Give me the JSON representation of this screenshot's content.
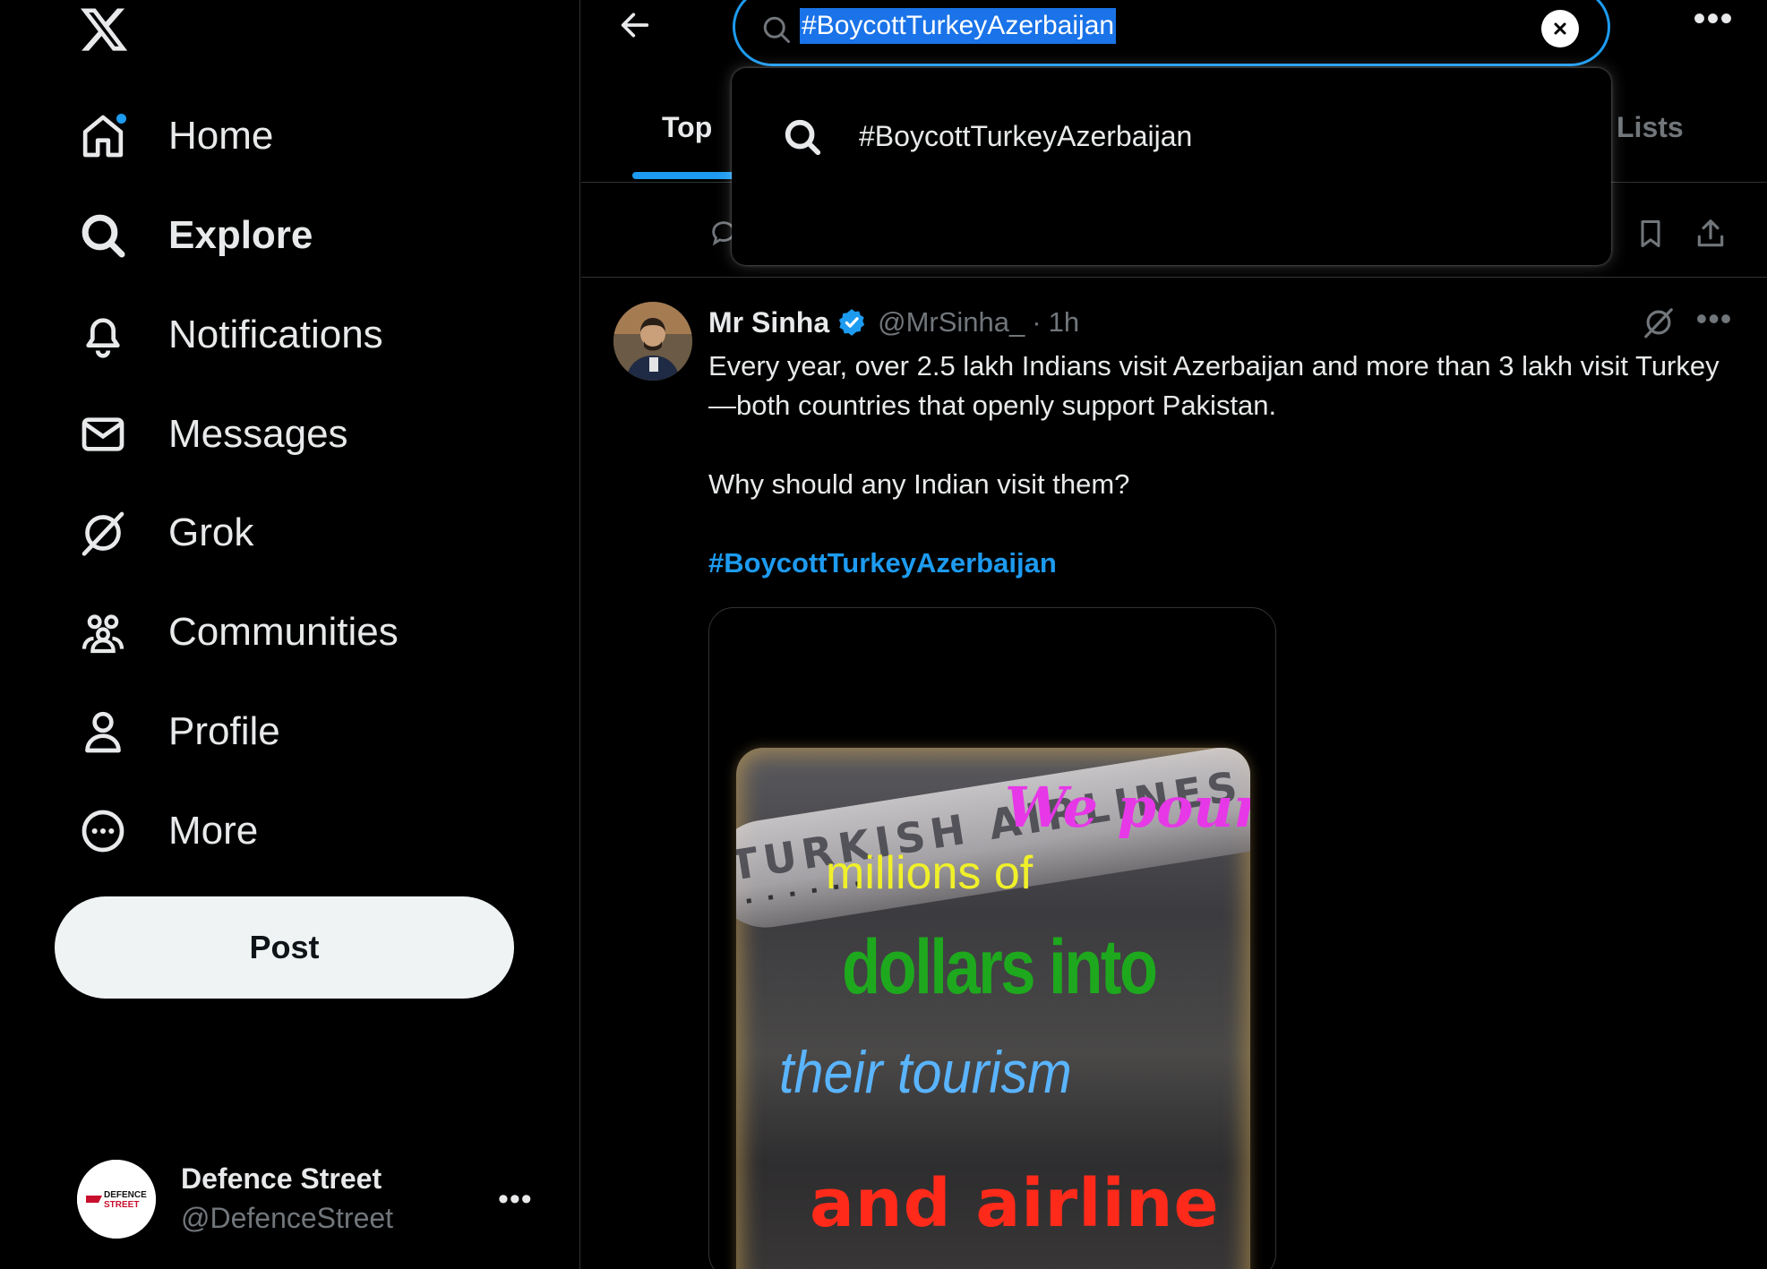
{
  "colors": {
    "background": "#000000",
    "accent": "#1d9bf0",
    "text_primary": "#e7e9ea",
    "text_secondary": "#71767b",
    "divider": "#2f3336",
    "post_button_bg": "#eff3f4"
  },
  "sidebar": {
    "logo_icon": "x-logo-icon",
    "nav": [
      {
        "label": "Home",
        "icon": "home-icon",
        "has_dot": true
      },
      {
        "label": "Explore",
        "icon": "search-icon",
        "active": true
      },
      {
        "label": "Notifications",
        "icon": "bell-icon"
      },
      {
        "label": "Messages",
        "icon": "envelope-icon"
      },
      {
        "label": "Grok",
        "icon": "grok-icon"
      },
      {
        "label": "Communities",
        "icon": "communities-icon"
      },
      {
        "label": "Profile",
        "icon": "person-icon"
      },
      {
        "label": "More",
        "icon": "more-circle-icon"
      }
    ],
    "post_button": "Post",
    "account": {
      "name": "Defence Street",
      "handle": "@DefenceStreet",
      "avatar_text": "DEFENCE STREET",
      "more": "•••"
    }
  },
  "header": {
    "search_value": "#BoycottTurkeyAzerbaijan",
    "more": "•••"
  },
  "search_dropdown": {
    "suggestion": "#BoycottTurkeyAzerbaijan"
  },
  "tabs": {
    "top": "Top",
    "lists": "Lists"
  },
  "tweet": {
    "name": "Mr Sinha",
    "handle": "@MrSinha_",
    "separator": "·",
    "time": "1h",
    "more": "•••",
    "body_line1": "Every year, over 2.5 lakh Indians visit Azerbaijan and more than 3 lakh visit Turkey—both countries that openly support Pakistan.",
    "body_line2": "Why should any Indian visit them?",
    "hashtag": "#BoycottTurkeyAzerbaijan",
    "media": {
      "airline_text": "TURKISH AIRLINES",
      "lines": [
        "We pour",
        "millions of",
        "dollars into",
        "their tourism",
        "and  airline"
      ]
    }
  }
}
